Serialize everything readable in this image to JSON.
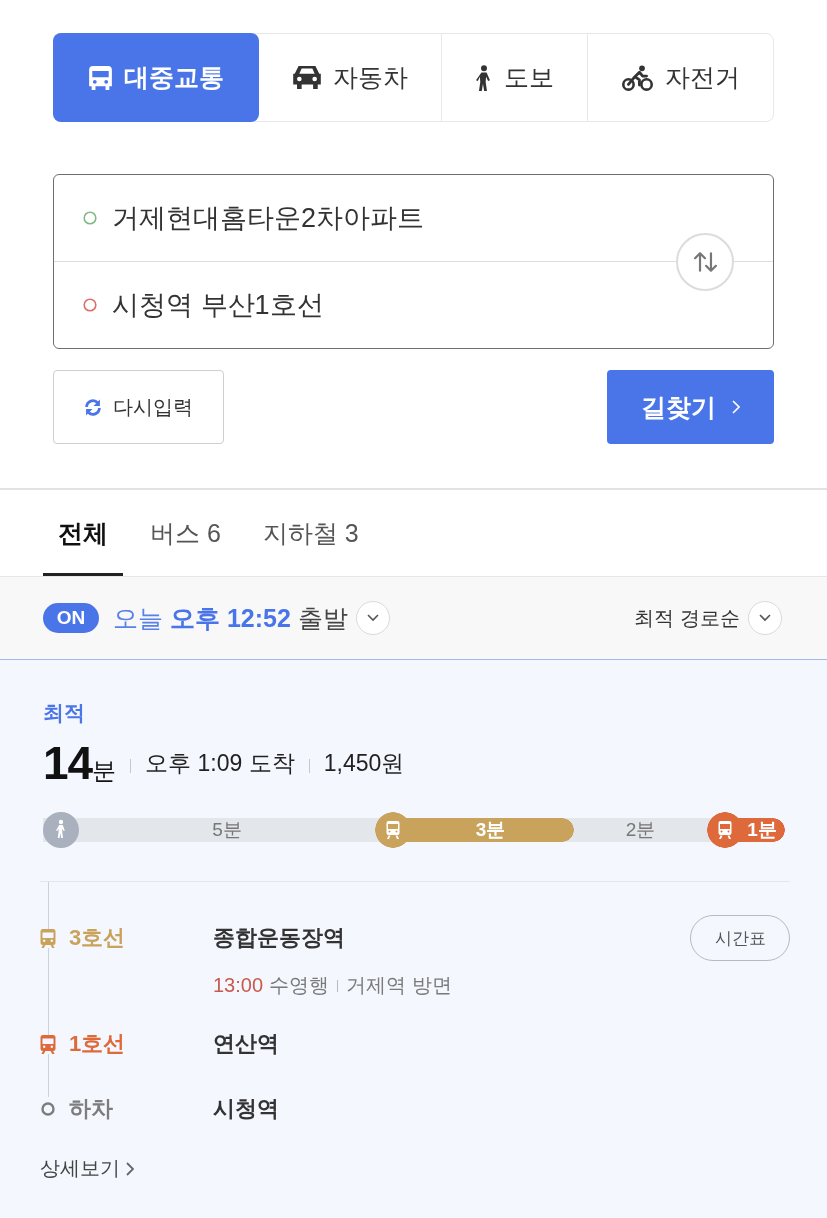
{
  "mode_tabs": [
    {
      "kind": "transit",
      "label": "대중교통",
      "selected": true
    },
    {
      "kind": "car",
      "label": "자동차",
      "selected": false
    },
    {
      "kind": "walk",
      "label": "도보",
      "selected": false
    },
    {
      "kind": "bike",
      "label": "자전거",
      "selected": false
    }
  ],
  "route_input": {
    "origin": "거제현대홈타운2차아파트",
    "destination": "시청역 부산1호선"
  },
  "actions": {
    "reset": "다시입력",
    "search": "길찾기"
  },
  "result_tabs": [
    {
      "label": "전체",
      "selected": true
    },
    {
      "label": "버스 6",
      "selected": false
    },
    {
      "label": "지하철 3",
      "selected": false
    }
  ],
  "departure": {
    "badge": "ON",
    "on": true,
    "day": "오늘",
    "time": "오후 12:52",
    "suffix": "출발"
  },
  "sort": {
    "label": "최적 경로순"
  },
  "route": {
    "tag": "최적",
    "duration_value": "14",
    "duration_unit": "분",
    "arrival": "오후 1:09 도착",
    "fare": "1,450원",
    "segments": [
      {
        "kind": "walk",
        "label": "5분"
      },
      {
        "kind": "subway",
        "label": "3분",
        "color": "#c9a35c"
      },
      {
        "kind": "walk",
        "label": "2분"
      },
      {
        "kind": "subway",
        "label": "1분",
        "color": "#de6a3c"
      }
    ],
    "steps": [
      {
        "kind": "subway",
        "label": "3호선",
        "color": "#c9a35c",
        "station": "종합운동장역",
        "timetable": "시간표",
        "departure_time": "13:00",
        "direction": "수영행",
        "platform": "거제역 방면"
      },
      {
        "kind": "subway",
        "label": "1호선",
        "color": "#de6a3c",
        "station": "연산역"
      },
      {
        "kind": "alight",
        "label": "하차",
        "color": "#7d7d7d",
        "station": "시청역"
      }
    ],
    "detail_link": "상세보기"
  }
}
